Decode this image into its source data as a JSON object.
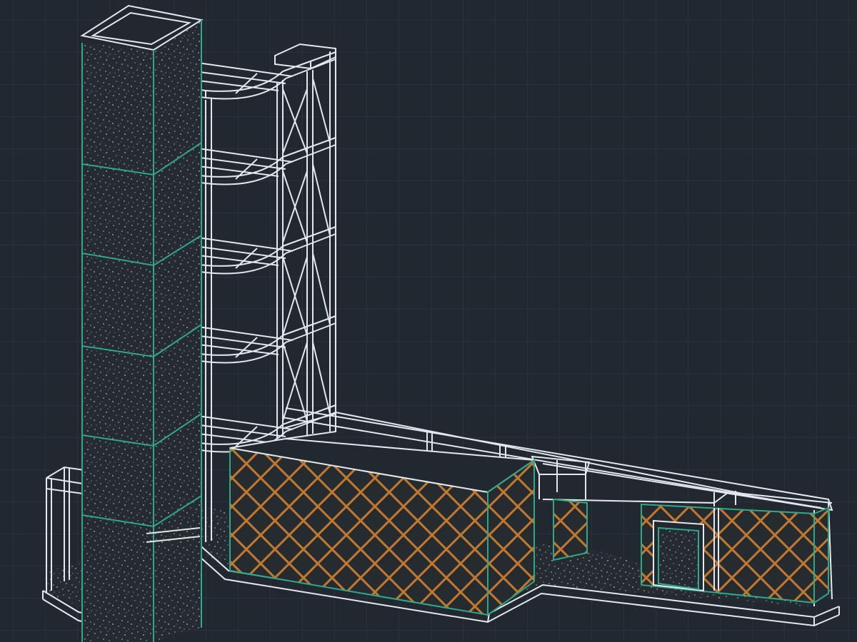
{
  "drawing": {
    "view": "isometric-wireframe",
    "elements": [
      "concrete-tower",
      "steel-frame",
      "floor-decks",
      "cross-bracing",
      "ramp-walkway",
      "hatched-panel-walls",
      "doorway-opening",
      "left-railing"
    ]
  },
  "colors": {
    "background": "#212830",
    "grid": "#323c48",
    "grid_major": "#3b4655",
    "wire": "#e4e8ec",
    "edge_green": "#2fa88a",
    "hatch_orange": "#c2782e",
    "concrete_dark": "#252b31",
    "speckle": "#9aa1a8",
    "panel_fill": "#262b30"
  }
}
